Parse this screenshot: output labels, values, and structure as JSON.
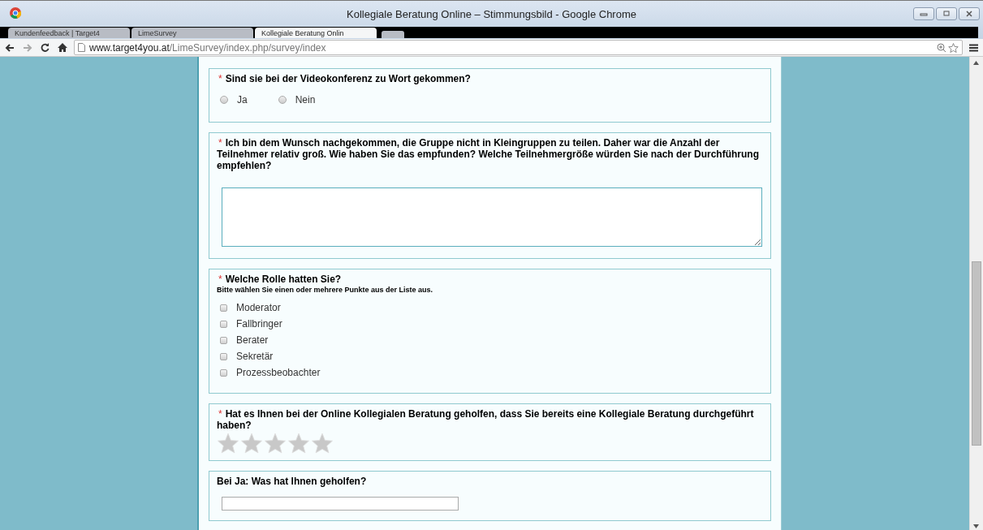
{
  "window": {
    "title": "Kollegiale Beratung Online – Stimmungsbild - Google Chrome"
  },
  "tabs": [
    {
      "label": "Kundenfeedback | Target4",
      "selected": false
    },
    {
      "label": "LimeSurvey",
      "selected": false
    },
    {
      "label": "Kollegiale Beratung Onlin",
      "selected": true
    }
  ],
  "address_bar": {
    "host": "www.target4you.at",
    "path": "/LimeSurvey/index.php/survey/index"
  },
  "questions": [
    {
      "kind": "radio",
      "required_mark": "*",
      "text": "Sind sie bei der Videokonferenz zu Wort gekommen?",
      "options": [
        {
          "label": "Ja",
          "selected": false
        },
        {
          "label": "Nein",
          "selected": false
        }
      ]
    },
    {
      "kind": "textarea",
      "required_mark": "*",
      "text": "Ich bin dem Wunsch nachgekommen, die Gruppe nicht in Kleingruppen zu teilen. Daher war die Anzahl der Teilnehmer relativ groß. Wie haben Sie das empfunden? Welche Teilnehmergröße würden Sie nach der Durchführung empfehlen?"
    },
    {
      "kind": "checkbox",
      "required_mark": "*",
      "text": "Welche Rolle hatten Sie?",
      "help": "Bitte wählen Sie einen oder mehrere Punkte aus der Liste aus.",
      "options": [
        {
          "label": "Moderator",
          "checked": false
        },
        {
          "label": "Fallbringer",
          "checked": false
        },
        {
          "label": "Berater",
          "checked": false
        },
        {
          "label": "Sekretär",
          "checked": false
        },
        {
          "label": "Prozessbeobachter",
          "checked": false
        }
      ]
    },
    {
      "kind": "rating",
      "required_mark": "*",
      "text": "Hat es Ihnen bei der Online Kollegialen Beratung geholfen, dass Sie bereits eine Kollegiale Beratung durchgeführt haben?",
      "stars": 0
    },
    {
      "kind": "text",
      "text": "Bei Ja: Was hat Ihnen geholfen?"
    }
  ]
}
